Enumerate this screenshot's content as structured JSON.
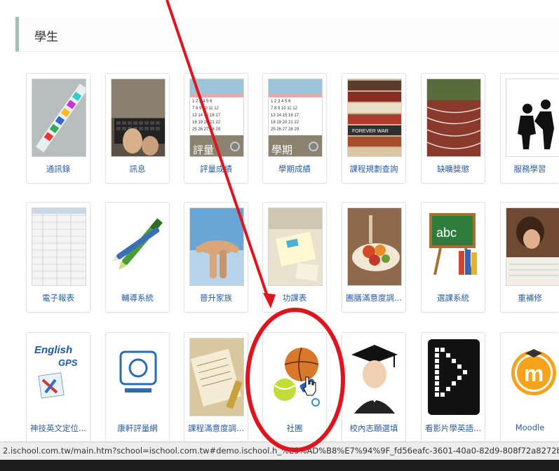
{
  "section": {
    "title": "學生"
  },
  "tiles": {
    "row1": [
      {
        "label": "通訊錄"
      },
      {
        "label": "訊息"
      },
      {
        "label": "評量成績",
        "thumb_text": "評量"
      },
      {
        "label": "學期成績",
        "thumb_text": "學期"
      },
      {
        "label": "課程規劃查詢",
        "thumb_text": "FOREVER WAR"
      },
      {
        "label": "缺曠獎懲"
      },
      {
        "label": "服務學習"
      }
    ],
    "row2": [
      {
        "label": "電子報表"
      },
      {
        "label": "輔導系統"
      },
      {
        "label": "晉升家族"
      },
      {
        "label": "功課表"
      },
      {
        "label": "團膳滿意度調..."
      },
      {
        "label": "選課系統",
        "thumb_text": "abc"
      },
      {
        "label": "重補修"
      }
    ],
    "row3": [
      {
        "label": "神技英文定位...",
        "thumb_text_1": "English",
        "thumb_text_2": "GPS"
      },
      {
        "label": "康軒評量網"
      },
      {
        "label": "課程滿意度調..."
      },
      {
        "label": "社團"
      },
      {
        "label": "校內志願選填"
      },
      {
        "label": "看影片學英語..."
      },
      {
        "label": "Moodle",
        "thumb_text": "m"
      }
    ]
  },
  "status_bar": {
    "url": "2.ischool.com.tw/main.htm?school=ischool.com.tw#demo.ischool.h_%E5%AD%B8%E7%94%9F_fd56eafc-3601-40a0-82d9-808f72a8272b"
  },
  "colors": {
    "label_link": "#2a5d9f",
    "annotation_red": "#e0141c",
    "header_accent": "#9fbfb7"
  }
}
